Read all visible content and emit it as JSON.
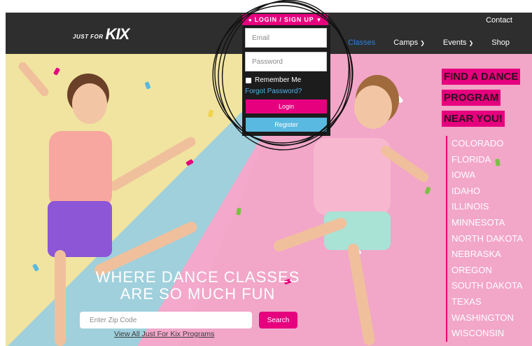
{
  "header": {
    "logo_small": "JUST FOR",
    "logo_big": "KIX",
    "contact": "Contact",
    "nav": [
      {
        "label": "Classes",
        "active": true
      },
      {
        "label": "Camps",
        "dropdown": true
      },
      {
        "label": "Events",
        "dropdown": true
      },
      {
        "label": "Shop"
      }
    ]
  },
  "login": {
    "tab_label": "LOGIN / SIGN UP",
    "email_placeholder": "Email",
    "password_placeholder": "Password",
    "remember_label": "Remember Me",
    "forgot_label": "Forgot Password?",
    "login_button": "Login",
    "register_button": "Register"
  },
  "find": {
    "lines": [
      "FIND A DANCE",
      "PROGRAM",
      "NEAR YOU!"
    ],
    "states": [
      "COLORADO",
      "FLORIDA",
      "IOWA",
      "IDAHO",
      "ILLINOIS",
      "MINNESOTA",
      "NORTH DAKOTA",
      "NEBRASKA",
      "OREGON",
      "SOUTH DAKOTA",
      "TEXAS",
      "WASHINGTON",
      "WISCONSIN"
    ]
  },
  "hero": {
    "headline_1": "WHERE DANCE CLASSES",
    "headline_2": "ARE SO MUCH FUN",
    "zip_placeholder": "Enter Zip Code",
    "search_button": "Search",
    "view_all": "View All Just For Kix Programs"
  },
  "colors": {
    "brand_pink": "#e6007e",
    "register_blue": "#5ab9e0",
    "navbar": "#2e2e2e"
  }
}
